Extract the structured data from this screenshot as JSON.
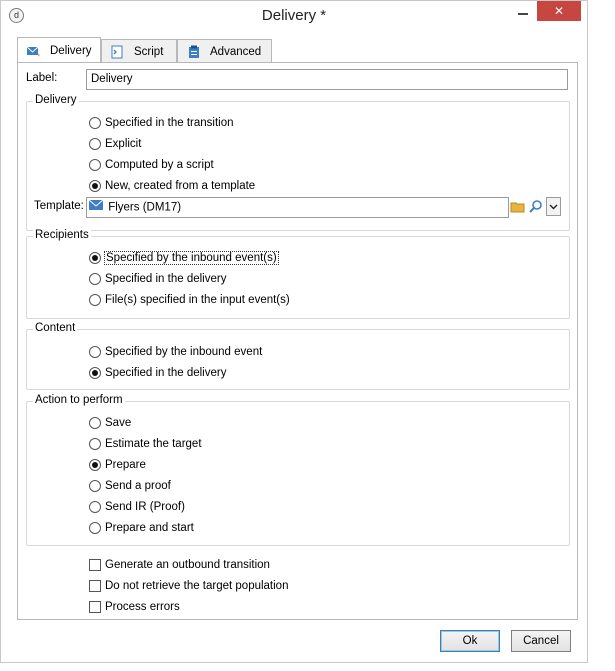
{
  "window": {
    "title": "Delivery *",
    "close_label": "✕"
  },
  "tabs": [
    {
      "label": "Delivery",
      "icon": "delivery-icon",
      "active": true
    },
    {
      "label": "Script",
      "icon": "script-icon",
      "active": false
    },
    {
      "label": "Advanced",
      "icon": "advanced-icon",
      "active": false
    }
  ],
  "label_field": {
    "label": "Label:",
    "value": "Delivery"
  },
  "delivery": {
    "title": "Delivery",
    "options": [
      {
        "label": "Specified in the transition",
        "checked": false
      },
      {
        "label": "Explicit",
        "checked": false
      },
      {
        "label": "Computed by a script",
        "checked": false
      },
      {
        "label": "New, created from a template",
        "checked": true
      }
    ],
    "template_label": "Template:",
    "template_value": "Flyers (DM17)"
  },
  "recipients": {
    "title": "Recipients",
    "options": [
      {
        "label": "Specified by the inbound event(s)",
        "checked": true
      },
      {
        "label": "Specified in the delivery",
        "checked": false
      },
      {
        "label": "File(s) specified in the input event(s)",
        "checked": false
      }
    ]
  },
  "content": {
    "title": "Content",
    "options": [
      {
        "label": "Specified by the inbound event",
        "checked": false
      },
      {
        "label": "Specified in the delivery",
        "checked": true
      }
    ]
  },
  "action": {
    "title": "Action to perform",
    "options": [
      {
        "label": "Save",
        "checked": false
      },
      {
        "label": "Estimate the target",
        "checked": false
      },
      {
        "label": "Prepare",
        "checked": true
      },
      {
        "label": "Send a proof",
        "checked": false
      },
      {
        "label": "Send IR (Proof)",
        "checked": false
      },
      {
        "label": "Prepare and start",
        "checked": false
      }
    ]
  },
  "checkboxes": [
    {
      "label": "Generate an outbound transition",
      "checked": false
    },
    {
      "label": "Do not retrieve the target population",
      "checked": false
    },
    {
      "label": "Process errors",
      "checked": false
    }
  ],
  "footer": {
    "ok_label": "Ok",
    "cancel_label": "Cancel"
  },
  "colors": {
    "accent": "#3c7fb1",
    "close": "#c7463f",
    "folder": "#e8b53a"
  }
}
